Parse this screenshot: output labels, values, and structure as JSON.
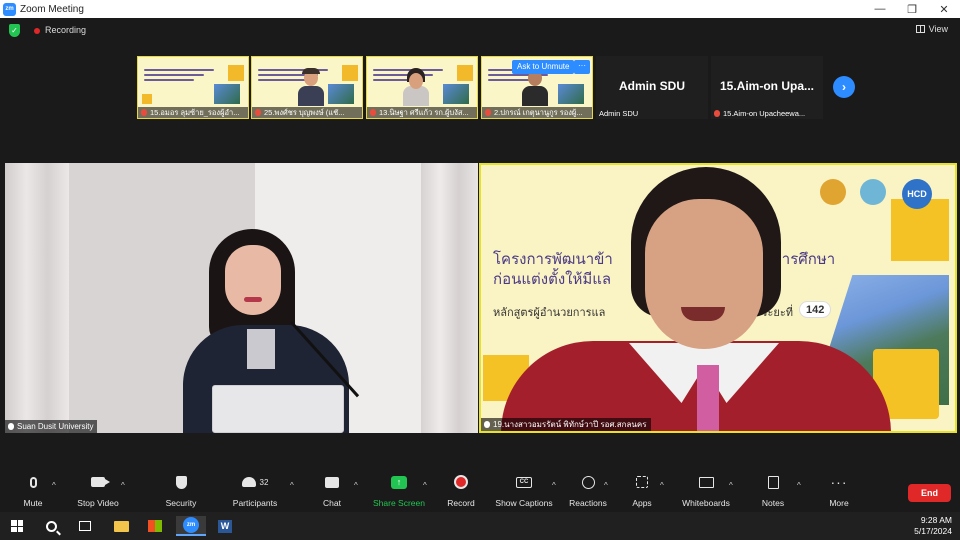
{
  "window": {
    "title": "Zoom Meeting",
    "controls": [
      "—",
      "❐",
      "✕"
    ]
  },
  "meeting_bar": {
    "recording_label": "Recording",
    "view_label": "View"
  },
  "thumbnails": [
    {
      "name": "15.อมอร ลุมซ้าย_รองผู้อำ..."
    },
    {
      "name": "25.พงศ์ชร บุญพงษ์ (แชั..."
    },
    {
      "name": "13.นิษฐา ศรีแก้ว รก.ผู้บงัส..."
    },
    {
      "name": "2.ปกรณ์ เกตุนานูกูร รองผู้...",
      "hover_button": "Ask to Unmute",
      "more_label": "···"
    },
    {
      "name": "Admin SDU",
      "display_name": "Admin SDU"
    },
    {
      "name": "15.Aim-on Upacheewa...",
      "display_name": "15.Aim-on Upa..."
    }
  ],
  "tiles": {
    "left": {
      "name": "Suan Dusit University"
    },
    "right": {
      "name": "19.นางสาวอมรรัตน์ พิทักษ์วาปี รอศ.สกลนคร",
      "slide_title_1": "โครงการพัฒนาข้า",
      "slide_title_1b": "รทางการศึกษา",
      "slide_title_2": "ก่อนแต่งตั้งให้มีแล",
      "slide_sub_1": "หลักสูตรผู้อำนวยการแล",
      "slide_sub_2": "นการพิเศษ ระยะที่",
      "slide_badge": "142",
      "logo_text": "HCD"
    }
  },
  "toolbar": {
    "mute": "Mute",
    "stop_video": "Stop Video",
    "security": "Security",
    "participants": "Participants",
    "participants_count": "32",
    "chat": "Chat",
    "share_screen": "Share Screen",
    "record": "Record",
    "show_captions": "Show Captions",
    "cc": "CC",
    "reactions": "Reactions",
    "apps": "Apps",
    "whiteboards": "Whiteboards",
    "notes": "Notes",
    "more": "More",
    "more_glyph": "···",
    "end": "End"
  },
  "taskbar": {
    "time": "9:28 AM",
    "date": "5/17/2024",
    "zoom_icon_text": "zm",
    "word_icon_text": "W"
  },
  "colors": {
    "accent": "#2d8cff",
    "end_red": "#e02828",
    "share_green": "#23c552",
    "active_speaker_border": "#e6e229"
  }
}
